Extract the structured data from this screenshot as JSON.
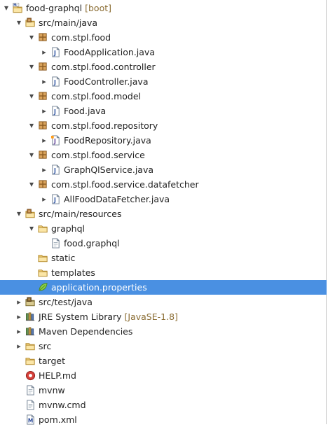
{
  "tree": [
    {
      "label": "food-graphql",
      "decoration": " [boot]",
      "icon": "maven-project-icon",
      "twisty": "expanded",
      "indent": 0
    },
    {
      "label": "src/main/java",
      "icon": "source-folder-icon",
      "twisty": "expanded",
      "indent": 1
    },
    {
      "label": "com.stpl.food",
      "icon": "package-icon",
      "twisty": "expanded",
      "indent": 2
    },
    {
      "label": "FoodApplication.java",
      "icon": "java-file-icon",
      "twisty": "collapsed",
      "indent": 3
    },
    {
      "label": "com.stpl.food.controller",
      "icon": "package-icon",
      "twisty": "expanded",
      "indent": 2
    },
    {
      "label": "FoodController.java",
      "icon": "java-file-icon",
      "twisty": "collapsed",
      "indent": 3
    },
    {
      "label": "com.stpl.food.model",
      "icon": "package-icon",
      "twisty": "expanded",
      "indent": 2
    },
    {
      "label": "Food.java",
      "icon": "java-file-icon",
      "twisty": "collapsed",
      "indent": 3
    },
    {
      "label": "com.stpl.food.repository",
      "icon": "package-icon",
      "twisty": "expanded",
      "indent": 2
    },
    {
      "label": "FoodRepository.java",
      "icon": "java-interface-file-icon",
      "twisty": "collapsed",
      "indent": 3
    },
    {
      "label": "com.stpl.food.service",
      "icon": "package-icon",
      "twisty": "expanded",
      "indent": 2
    },
    {
      "label": "GraphQlService.java",
      "icon": "java-file-icon",
      "twisty": "collapsed",
      "indent": 3
    },
    {
      "label": "com.stpl.food.service.datafetcher",
      "icon": "package-icon",
      "twisty": "expanded",
      "indent": 2
    },
    {
      "label": "AllFoodDataFetcher.java",
      "icon": "java-file-icon",
      "twisty": "collapsed",
      "indent": 3
    },
    {
      "label": "src/main/resources",
      "icon": "source-folder-icon",
      "twisty": "expanded",
      "indent": 1
    },
    {
      "label": "graphql",
      "icon": "folder-icon",
      "twisty": "expanded",
      "indent": 2
    },
    {
      "label": "food.graphql",
      "icon": "text-file-icon",
      "twisty": "none",
      "indent": 3
    },
    {
      "label": "static",
      "icon": "folder-icon",
      "twisty": "none",
      "indent": 2
    },
    {
      "label": "templates",
      "icon": "folder-icon",
      "twisty": "none",
      "indent": 2
    },
    {
      "label": "application.properties",
      "icon": "spring-leaf-icon",
      "twisty": "none",
      "indent": 2,
      "selected": true
    },
    {
      "label": "src/test/java",
      "icon": "test-source-folder-icon",
      "twisty": "collapsed",
      "indent": 1
    },
    {
      "label": "JRE System Library",
      "decoration": " [JavaSE-1.8]",
      "icon": "library-icon",
      "twisty": "collapsed",
      "indent": 1
    },
    {
      "label": "Maven Dependencies",
      "icon": "library-icon",
      "twisty": "collapsed",
      "indent": 1
    },
    {
      "label": "src",
      "icon": "folder-icon",
      "twisty": "collapsed",
      "indent": 1
    },
    {
      "label": "target",
      "icon": "folder-icon",
      "twisty": "none",
      "indent": 1
    },
    {
      "label": "HELP.md",
      "icon": "markdown-file-icon",
      "twisty": "none",
      "indent": 1
    },
    {
      "label": "mvnw",
      "icon": "text-file-icon",
      "twisty": "none",
      "indent": 1
    },
    {
      "label": "mvnw.cmd",
      "icon": "text-file-icon",
      "twisty": "none",
      "indent": 1
    },
    {
      "label": "pom.xml",
      "icon": "maven-pom-icon",
      "twisty": "none",
      "indent": 1
    }
  ]
}
